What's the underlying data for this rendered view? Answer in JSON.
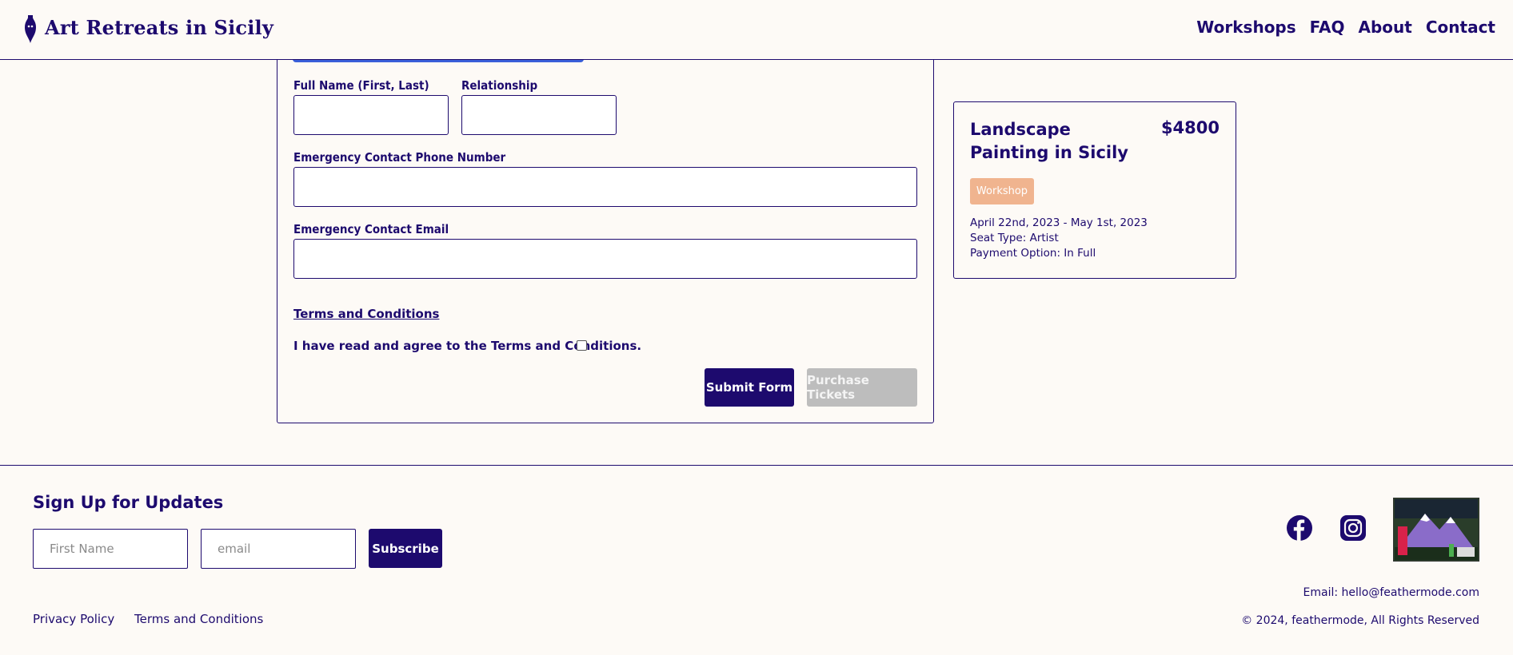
{
  "header": {
    "site_title": "Art Retreats in Sicily",
    "logo_icon": "vase-icon",
    "nav": [
      "Workshops",
      "FAQ",
      "About",
      "Contact"
    ]
  },
  "form": {
    "full_name_label": "Full Name (First, Last)",
    "relationship_label": "Relationship",
    "phone_label": "Emergency Contact Phone Number",
    "email_label": "Emergency Contact Email",
    "full_name_value": "",
    "relationship_value": "",
    "phone_value": "",
    "email_value": "",
    "terms_link": "Terms and Conditions",
    "agree_text": "I have read and agree to the Terms and Conditions.",
    "agree_checked": false,
    "submit_label": "Submit Form",
    "purchase_label": "Purchase Tickets"
  },
  "summary": {
    "title": "Landscape Painting in Sicily",
    "price": "$4800",
    "badge": "Workshop",
    "dates": "April 22nd, 2023 - May 1st, 2023",
    "seat_type": "Seat Type: Artist",
    "payment_option": "Payment Option: In Full"
  },
  "footer": {
    "signup_title": "Sign Up for Updates",
    "first_name_placeholder": "First Name",
    "email_placeholder": "email",
    "subscribe_label": "Subscribe",
    "links": [
      "Privacy Policy",
      "Terms and Conditions"
    ],
    "social_icons": [
      "facebook-icon",
      "instagram-icon"
    ],
    "badge_icon": "colorado-badge-icon",
    "contact_email": "Email: hello@feathermode.com",
    "copyright": "© 2024, feathermode, All Rights Reserved"
  },
  "colors": {
    "primary": "#1d0a6e",
    "accent_blue": "#3a5fd9",
    "badge": "#f0b48f",
    "disabled": "#bdbdbd",
    "background": "#fdfaf6"
  }
}
